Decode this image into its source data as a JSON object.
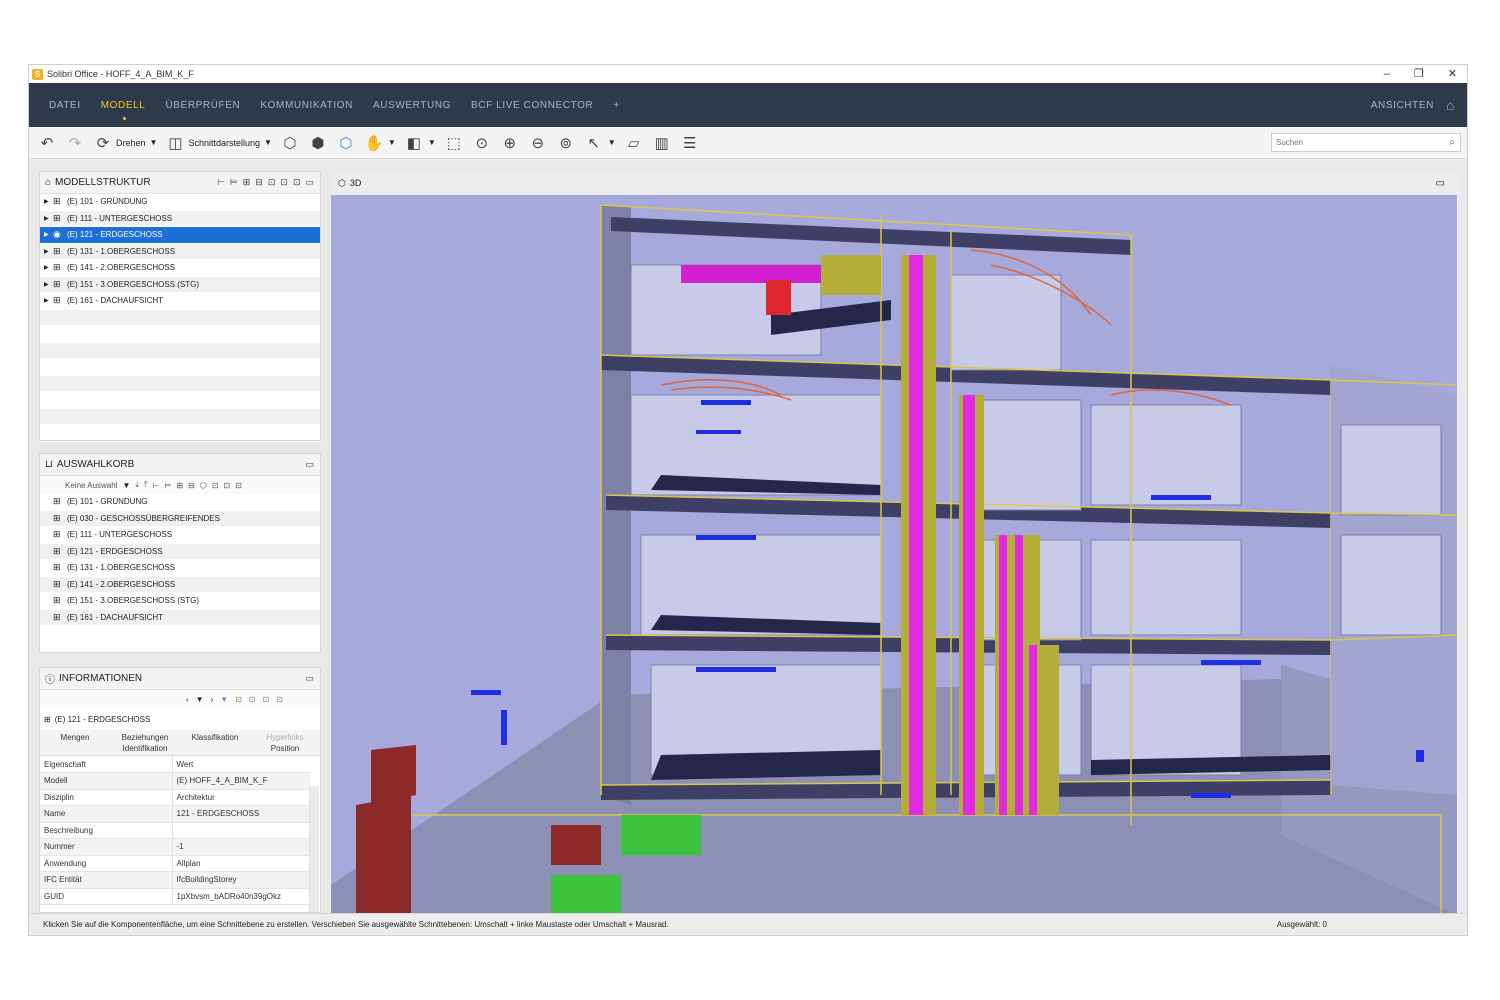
{
  "window": {
    "title": "Solibri Office - HOFF_4_A_BIM_K_F",
    "controls": [
      "–",
      "❐",
      "✕"
    ]
  },
  "menu": {
    "items": [
      "DATEI",
      "MODELL",
      "ÜBERPRÜFEN",
      "KOMMUNIKATION",
      "AUSWERTUNG",
      "BCF LIVE CONNECTOR",
      "+"
    ],
    "active": "MODELL",
    "right_label": "ANSICHTEN",
    "accent": "#f5c623"
  },
  "toolbar": {
    "rotate_label": "Drehen",
    "section_label": "Schnittdarstellung",
    "search_placeholder": "Suchen"
  },
  "modellstruktur": {
    "title": "MODELLSTRUKTUR",
    "items": [
      "(E) 101 - GRÜNDUNG",
      "(E) 111 - UNTERGESCHOSS",
      "(E) 121 - ERDGESCHOSS",
      "(E) 131 - 1.OBERGESCHOSS",
      "(E) 141 - 2.OBERGESCHOSS",
      "(E) 151 - 3.OBERGESCHOSS (STG)",
      "(E) 161 - DACHAUFSICHT"
    ],
    "selected_index": 2
  },
  "auswahlkorb": {
    "title": "AUSWAHLKORB",
    "dropdown": "Keine Auswahl",
    "items": [
      "(E) 101 - GRÜNDUNG",
      "(E) 030 - GESCHOSSÜBERGREIFENDES",
      "(E) 111 - UNTERGESCHOSS",
      "(E) 121 - ERDGESCHOSS",
      "(E) 131 - 1.OBERGESCHOSS",
      "(E) 141 - 2.OBERGESCHOSS",
      "(E) 151 - 3.OBERGESCHOSS (STG)",
      "(E) 161 - DACHAUFSICHT"
    ]
  },
  "informationen": {
    "title": "INFORMATIONEN",
    "object": "(E) 121 - ERDGESCHOSS",
    "tabs": {
      "mengen": "Mengen",
      "beziehungen": "Beziehungen",
      "identifikation": "Identifikation",
      "klassifikation": "Klassifikation",
      "position": "Position",
      "hyperlinks": "Hyperlinks"
    },
    "header": {
      "key": "Eigenschaft",
      "value": "Wert"
    },
    "rows": [
      {
        "key": "Modell",
        "value": "(E) HOFF_4_A_BIM_K_F"
      },
      {
        "key": "Disziplin",
        "value": "Architektur"
      },
      {
        "key": "Name",
        "value": "121 - ERDGESCHOSS"
      },
      {
        "key": "Beschreibung",
        "value": ""
      },
      {
        "key": "Nummer",
        "value": "-1"
      },
      {
        "key": "Anwendung",
        "value": "Allplan"
      },
      {
        "key": "IFC Entität",
        "value": "IfcBuildingStorey"
      },
      {
        "key": "GUID",
        "value": "1pXbvsm_bADRo40n39gOkz"
      }
    ]
  },
  "viewport": {
    "title": "3D",
    "background": "#a7a8dc"
  },
  "status": {
    "hint": "Klicken Sie auf die Komponentenfläche, um eine Schnittebene zu erstellen. Verschieben Sie ausgewählte Schnittebenen: Umschalt + linke Maustaste oder Umschalt + Mausrad.",
    "selected": "Ausgewählt: 0"
  },
  "icons": [
    "undo-icon",
    "redo-icon",
    "rotate-icon",
    "section-icon",
    "zoom-in-icon",
    "zoom-out-icon",
    "search-icon",
    "views-icon",
    "maximize-icon"
  ]
}
